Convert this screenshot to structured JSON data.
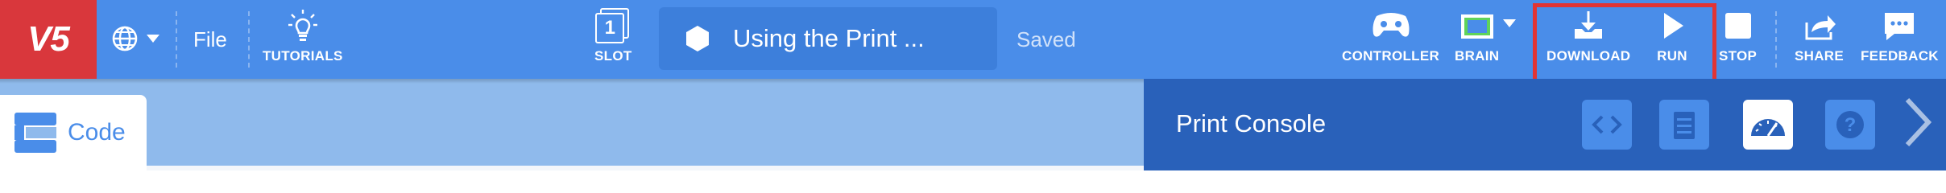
{
  "header": {
    "logo_text": "V5",
    "file_label": "File",
    "tutorials_label": "TUTORIALS",
    "slot_label": "SLOT",
    "slot_number": "1",
    "project_name": "Using the Print ...",
    "save_status": "Saved",
    "controller_label": "CONTROLLER",
    "brain_label": "BRAIN",
    "download_label": "DOWNLOAD",
    "run_label": "RUN",
    "stop_label": "STOP",
    "share_label": "SHARE",
    "feedback_label": "FEEDBACK"
  },
  "workspace": {
    "code_tab_label": "Code"
  },
  "console": {
    "title": "Print Console",
    "buttons": [
      "code-view-icon",
      "device-icon",
      "dashboard-icon",
      "help-icon"
    ]
  },
  "colors": {
    "header_bg": "#4a8de9",
    "logo_bg": "#d9373c",
    "console_bg": "#2961ba",
    "highlight": "#e23434",
    "brain_green": "#5fd35a"
  }
}
